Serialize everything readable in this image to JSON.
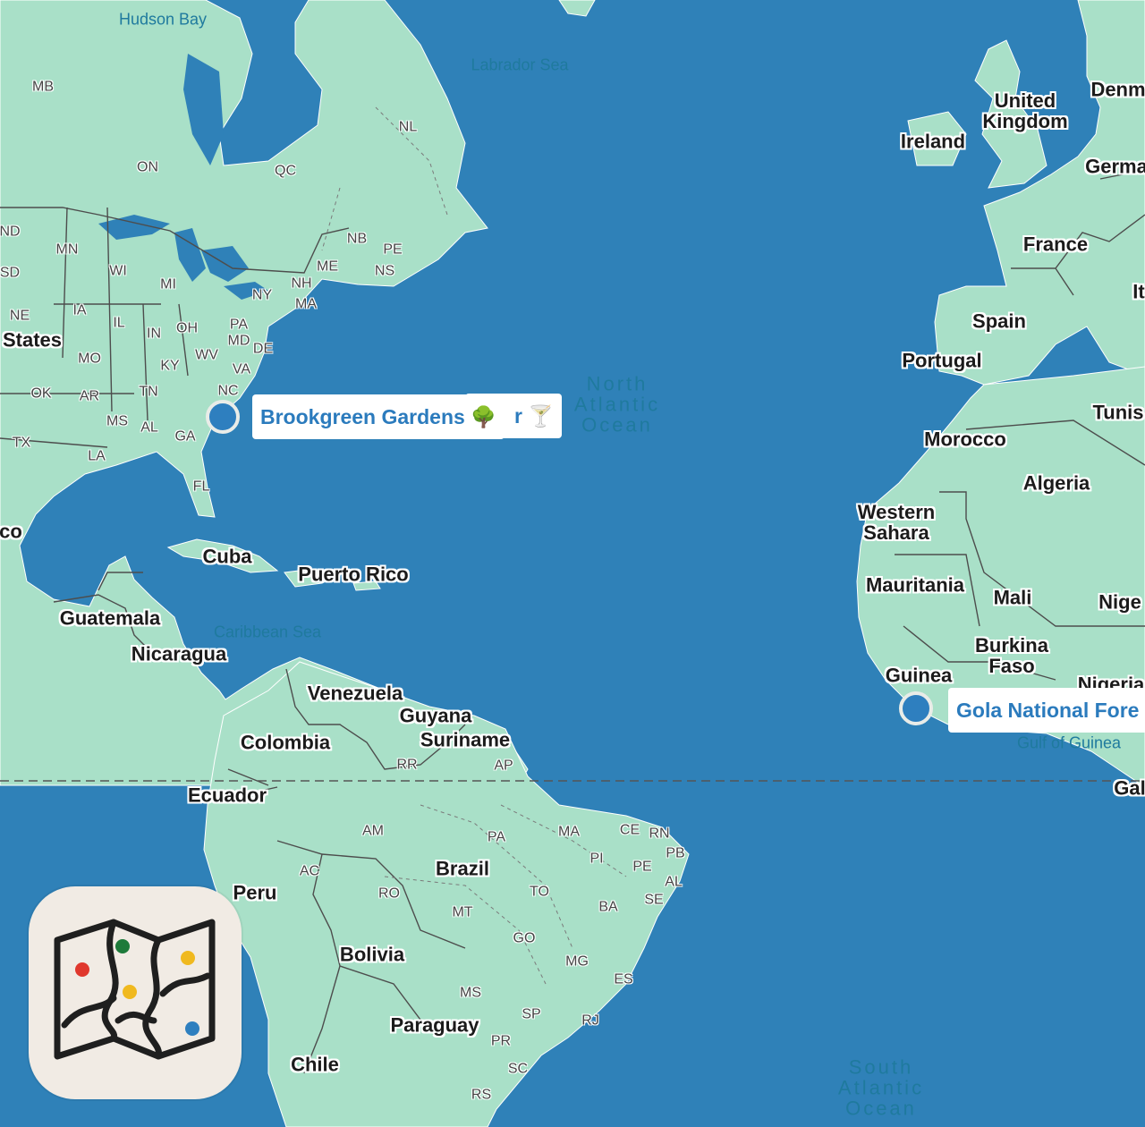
{
  "map": {
    "colors": {
      "ocean": "#2f81b8",
      "land": "#a9e0c8",
      "border": "#4a4a4a",
      "pin": "#2e7fbf"
    },
    "water_labels": [
      {
        "id": "hudson-bay",
        "text": "Hudson Bay"
      },
      {
        "id": "labrador-sea",
        "text": "Labrador Sea"
      },
      {
        "id": "north-atlantic",
        "text": "North Atlantic Ocean"
      },
      {
        "id": "caribbean-sea",
        "text": "Caribbean Sea"
      },
      {
        "id": "gulf-of-guinea",
        "text": "Gulf of Guinea"
      },
      {
        "id": "south-atlantic",
        "text": "South Atlantic Ocean"
      }
    ],
    "countries": [
      "United Kingdom",
      "Ireland",
      "Denm",
      "Germa",
      "France",
      "Spain",
      "Portugal",
      "It",
      "Tunis",
      "Morocco",
      "Algeria",
      "Western Sahara",
      "Mauritania",
      "Mali",
      "Nige",
      "Burkina Faso",
      "Guinea",
      "Nigeria",
      "Gal",
      "States",
      "co",
      "Cuba",
      "Puerto Rico",
      "Guatemala",
      "Nicaragua",
      "Venezuela",
      "Guyana",
      "Suriname",
      "Colombia",
      "Ecuador",
      "Peru",
      "Brazil",
      "Bolivia",
      "Paraguay",
      "Chile"
    ],
    "states": [
      "MB",
      "ON",
      "QC",
      "NL",
      "NB",
      "PE",
      "NS",
      "ND",
      "MN",
      "SD",
      "WI",
      "MI",
      "NY",
      "ME",
      "NH",
      "MA",
      "NE",
      "IA",
      "IL",
      "IN",
      "OH",
      "PA",
      "MD",
      "DE",
      "MO",
      "KY",
      "WV",
      "VA",
      "OK",
      "AR",
      "TN",
      "NC",
      "TX",
      "MS",
      "AL",
      "GA",
      "LA",
      "FL",
      "RR",
      "AP",
      "AM",
      "PA",
      "MA",
      "CE",
      "RN",
      "PB",
      "PI",
      "PE",
      "AL",
      "SE",
      "AC",
      "RO",
      "MT",
      "TO",
      "BA",
      "GO",
      "MG",
      "ES",
      "MS",
      "SP",
      "RJ",
      "PR",
      "SC",
      "RS"
    ]
  },
  "places": [
    {
      "id": "brookgreen",
      "name": "Brookgreen Gardens",
      "emoji": "🌳",
      "behind_fragment": "r",
      "behind_emoji": "🍸"
    },
    {
      "id": "gola",
      "name": "Gola National Fore"
    }
  ],
  "app": {
    "icon_name": "folded-map-icon",
    "pin_colors": [
      "#e0382d",
      "#1e7a3a",
      "#f0b91f",
      "#f0b91f",
      "#2e7fbf"
    ]
  }
}
